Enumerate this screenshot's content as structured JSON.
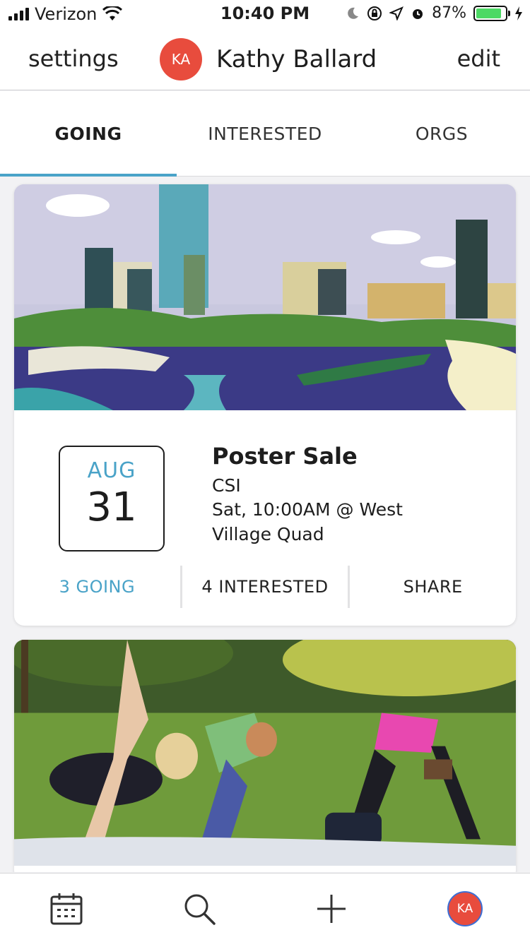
{
  "status_bar": {
    "carrier": "Verizon",
    "time": "10:40 PM",
    "battery": "87%",
    "battery_level": 0.87
  },
  "header": {
    "settings_label": "settings",
    "avatar_initials": "KA",
    "user_name": "Kathy Ballard",
    "edit_label": "edit"
  },
  "tabs": [
    {
      "label": "GOING",
      "active": true
    },
    {
      "label": "INTERESTED",
      "active": false
    },
    {
      "label": "ORGS",
      "active": false
    }
  ],
  "events": [
    {
      "month": "AUG",
      "day": "31",
      "title": "Poster Sale",
      "org": "CSI",
      "when": "Sat, 10:00AM @ West Village Quad",
      "going_label": "3 GOING",
      "interested_label": "4 INTERESTED",
      "share_label": "SHARE"
    }
  ],
  "bottom_nav": {
    "avatar_initials": "KA",
    "items": [
      "calendar-icon",
      "search-icon",
      "add-icon",
      "profile-avatar"
    ]
  },
  "colors": {
    "accent": "#4aa3c8",
    "avatar": "#e84c3d",
    "battery": "#4cd964"
  }
}
